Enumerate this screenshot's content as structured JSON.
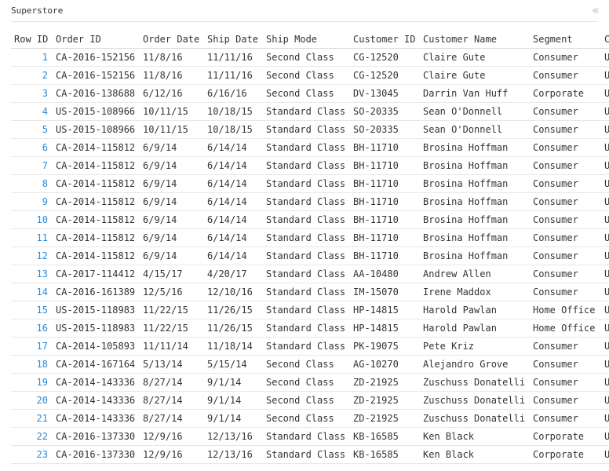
{
  "window": {
    "title": "Superstore",
    "collapse_icon": "double-chevron-left-icon",
    "collapse_glyph": "«"
  },
  "table": {
    "columns": [
      "Row ID",
      "Order ID",
      "Order Date",
      "Ship Date",
      "Ship Mode",
      "Customer ID",
      "Customer Name",
      "Segment",
      "Country"
    ],
    "rows": [
      [
        "1",
        "CA-2016-152156",
        "11/8/16",
        "11/11/16",
        "Second Class",
        "CG-12520",
        "Claire Gute",
        "Consumer",
        "United States"
      ],
      [
        "2",
        "CA-2016-152156",
        "11/8/16",
        "11/11/16",
        "Second Class",
        "CG-12520",
        "Claire Gute",
        "Consumer",
        "United States"
      ],
      [
        "3",
        "CA-2016-138688",
        "6/12/16",
        "6/16/16",
        "Second Class",
        "DV-13045",
        "Darrin Van Huff",
        "Corporate",
        "United States"
      ],
      [
        "4",
        "US-2015-108966",
        "10/11/15",
        "10/18/15",
        "Standard Class",
        "SO-20335",
        "Sean O'Donnell",
        "Consumer",
        "United States"
      ],
      [
        "5",
        "US-2015-108966",
        "10/11/15",
        "10/18/15",
        "Standard Class",
        "SO-20335",
        "Sean O'Donnell",
        "Consumer",
        "United States"
      ],
      [
        "6",
        "CA-2014-115812",
        "6/9/14",
        "6/14/14",
        "Standard Class",
        "BH-11710",
        "Brosina Hoffman",
        "Consumer",
        "United States"
      ],
      [
        "7",
        "CA-2014-115812",
        "6/9/14",
        "6/14/14",
        "Standard Class",
        "BH-11710",
        "Brosina Hoffman",
        "Consumer",
        "United States"
      ],
      [
        "8",
        "CA-2014-115812",
        "6/9/14",
        "6/14/14",
        "Standard Class",
        "BH-11710",
        "Brosina Hoffman",
        "Consumer",
        "United States"
      ],
      [
        "9",
        "CA-2014-115812",
        "6/9/14",
        "6/14/14",
        "Standard Class",
        "BH-11710",
        "Brosina Hoffman",
        "Consumer",
        "United States"
      ],
      [
        "10",
        "CA-2014-115812",
        "6/9/14",
        "6/14/14",
        "Standard Class",
        "BH-11710",
        "Brosina Hoffman",
        "Consumer",
        "United States"
      ],
      [
        "11",
        "CA-2014-115812",
        "6/9/14",
        "6/14/14",
        "Standard Class",
        "BH-11710",
        "Brosina Hoffman",
        "Consumer",
        "United States"
      ],
      [
        "12",
        "CA-2014-115812",
        "6/9/14",
        "6/14/14",
        "Standard Class",
        "BH-11710",
        "Brosina Hoffman",
        "Consumer",
        "United States"
      ],
      [
        "13",
        "CA-2017-114412",
        "4/15/17",
        "4/20/17",
        "Standard Class",
        "AA-10480",
        "Andrew Allen",
        "Consumer",
        "United States"
      ],
      [
        "14",
        "CA-2016-161389",
        "12/5/16",
        "12/10/16",
        "Standard Class",
        "IM-15070",
        "Irene Maddox",
        "Consumer",
        "United States"
      ],
      [
        "15",
        "US-2015-118983",
        "11/22/15",
        "11/26/15",
        "Standard Class",
        "HP-14815",
        "Harold Pawlan",
        "Home Office",
        "United States"
      ],
      [
        "16",
        "US-2015-118983",
        "11/22/15",
        "11/26/15",
        "Standard Class",
        "HP-14815",
        "Harold Pawlan",
        "Home Office",
        "United States"
      ],
      [
        "17",
        "CA-2014-105893",
        "11/11/14",
        "11/18/14",
        "Standard Class",
        "PK-19075",
        "Pete Kriz",
        "Consumer",
        "United States"
      ],
      [
        "18",
        "CA-2014-167164",
        "5/13/14",
        "5/15/14",
        "Second Class",
        "AG-10270",
        "Alejandro Grove",
        "Consumer",
        "United States"
      ],
      [
        "19",
        "CA-2014-143336",
        "8/27/14",
        "9/1/14",
        "Second Class",
        "ZD-21925",
        "Zuschuss Donatelli",
        "Consumer",
        "United States"
      ],
      [
        "20",
        "CA-2014-143336",
        "8/27/14",
        "9/1/14",
        "Second Class",
        "ZD-21925",
        "Zuschuss Donatelli",
        "Consumer",
        "United States"
      ],
      [
        "21",
        "CA-2014-143336",
        "8/27/14",
        "9/1/14",
        "Second Class",
        "ZD-21925",
        "Zuschuss Donatelli",
        "Consumer",
        "United States"
      ],
      [
        "22",
        "CA-2016-137330",
        "12/9/16",
        "12/13/16",
        "Standard Class",
        "KB-16585",
        "Ken Black",
        "Corporate",
        "United States"
      ],
      [
        "23",
        "CA-2016-137330",
        "12/9/16",
        "12/13/16",
        "Standard Class",
        "KB-16585",
        "Ken Black",
        "Corporate",
        "United States"
      ]
    ]
  },
  "colors": {
    "row_id_link": "#2a8ad6",
    "text": "#333333",
    "header_rule": "#d8d8d8",
    "row_rule": "#e8e8e8",
    "collapse_icon": "#bbbbbb"
  }
}
